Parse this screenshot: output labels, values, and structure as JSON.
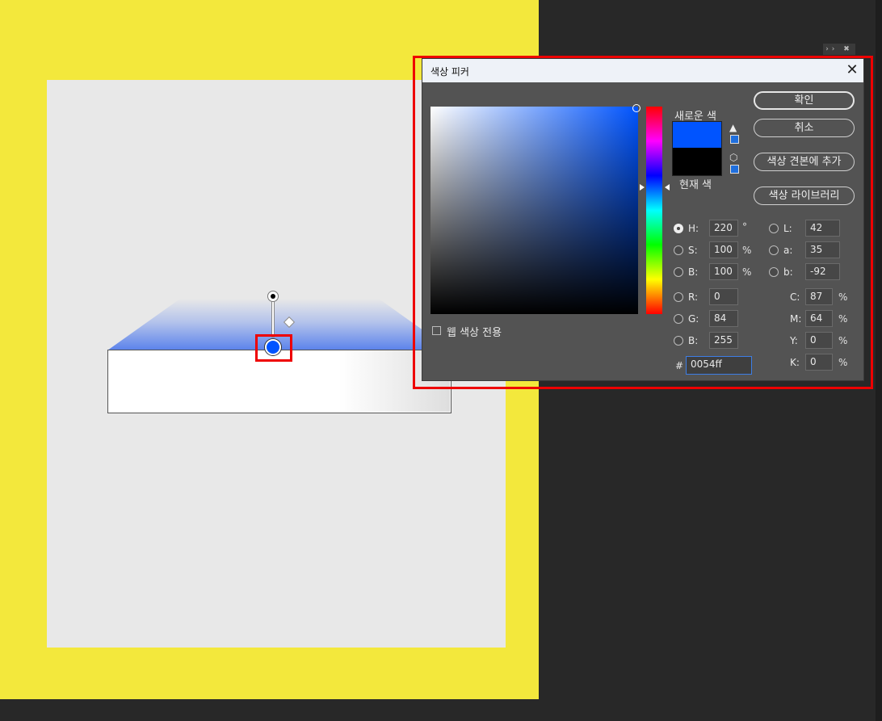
{
  "dialog": {
    "title": "색상 피커",
    "new_color_label": "새로운 색",
    "current_color_label": "현재 색",
    "new_color": "#0054ff",
    "current_color": "#000000",
    "web_colors_only_label": "웹 색상 전용",
    "buttons": {
      "ok": "확인",
      "cancel": "취소",
      "add_to_swatches": "색상 견본에 추가",
      "color_libraries": "색상 라이브러리"
    },
    "hsb": {
      "h_label": "H:",
      "h_value": "220",
      "h_unit": "°",
      "s_label": "S:",
      "s_value": "100",
      "s_unit": "%",
      "b_label": "B:",
      "b_value": "100",
      "b_unit": "%"
    },
    "rgb": {
      "r_label": "R:",
      "r_value": "0",
      "g_label": "G:",
      "g_value": "84",
      "b_label": "B:",
      "b_value": "255"
    },
    "lab": {
      "l_label": "L:",
      "l_value": "42",
      "a_label": "a:",
      "a_value": "35",
      "b_label": "b:",
      "b_value": "-92"
    },
    "cmyk": {
      "c_label": "C:",
      "c_value": "87",
      "c_unit": "%",
      "m_label": "M:",
      "m_value": "64",
      "m_unit": "%",
      "y_label": "Y:",
      "y_value": "0",
      "y_unit": "%",
      "k_label": "K:",
      "k_value": "0",
      "k_unit": "%"
    },
    "hex_label": "#",
    "hex_value": "0054ff",
    "selected_mode": "H"
  },
  "icons": {
    "close": "close-icon",
    "gamut_warning": "warning-icon",
    "web_safe": "cube-icon"
  },
  "panel_controls": "›› ✖",
  "colors": {
    "artboard_border": "#f3e83c",
    "highlight": "#e00000",
    "gradient_stop": "#0054ff"
  }
}
